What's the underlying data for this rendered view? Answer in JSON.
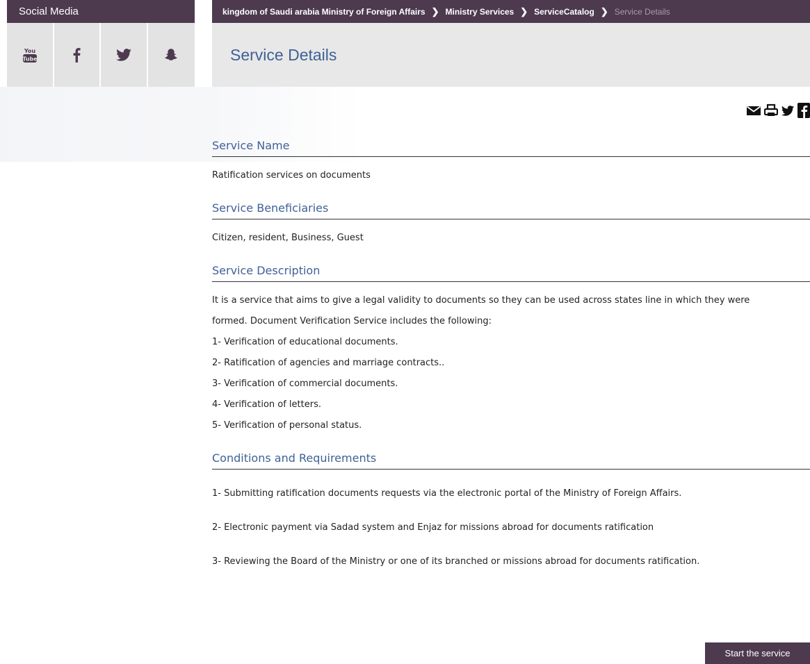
{
  "sidebar": {
    "title": "Social Media",
    "social_links": [
      {
        "icon": "youtube-icon"
      },
      {
        "icon": "facebook-icon"
      },
      {
        "icon": "twitter-icon"
      },
      {
        "icon": "snapchat-icon"
      }
    ]
  },
  "breadcrumb": {
    "items": [
      "kingdom of Saudi arabia Ministry of Foreign Affairs",
      "Ministry Services",
      "ServiceCatalog"
    ],
    "current": "Service Details",
    "separator": "❯"
  },
  "page_title": "Service Details",
  "share_icons": [
    "email-icon",
    "print-icon",
    "twitter-icon",
    "facebook-icon"
  ],
  "sections": {
    "service_name": {
      "heading": "Service Name",
      "text": "Ratification services on documents"
    },
    "beneficiaries": {
      "heading": "Service Beneficiaries",
      "text": "Citizen, resident, Business, Guest"
    },
    "description": {
      "heading": "Service Description",
      "lines": [
        "It is a service that aims to give a legal validity to documents so they can be used across states line in which they were",
        "formed. Document Verification Service includes the following:",
        "1- Verification of educational documents.",
        "2- Ratification of agencies and marriage contracts..",
        "3- Verification of commercial documents.",
        "4- Verification of letters.",
        "5- Verification of personal status."
      ]
    },
    "requirements": {
      "heading": "Conditions and Requirements",
      "lines": [
        "1- Submitting ratification documents requests via the electronic portal of the Ministry of Foreign Affairs.",
        "2- Electronic payment via Sadad system and Enjaz for missions abroad for documents ratification",
        "3- Reviewing the Board of the Ministry or one of its branched or missions abroad for documents ratification."
      ]
    }
  },
  "start_button": "Start the service",
  "colors": {
    "header_bg": "#4d3a4f",
    "heading_blue": "#3f6196",
    "panel_gray": "#e8e8e8"
  }
}
